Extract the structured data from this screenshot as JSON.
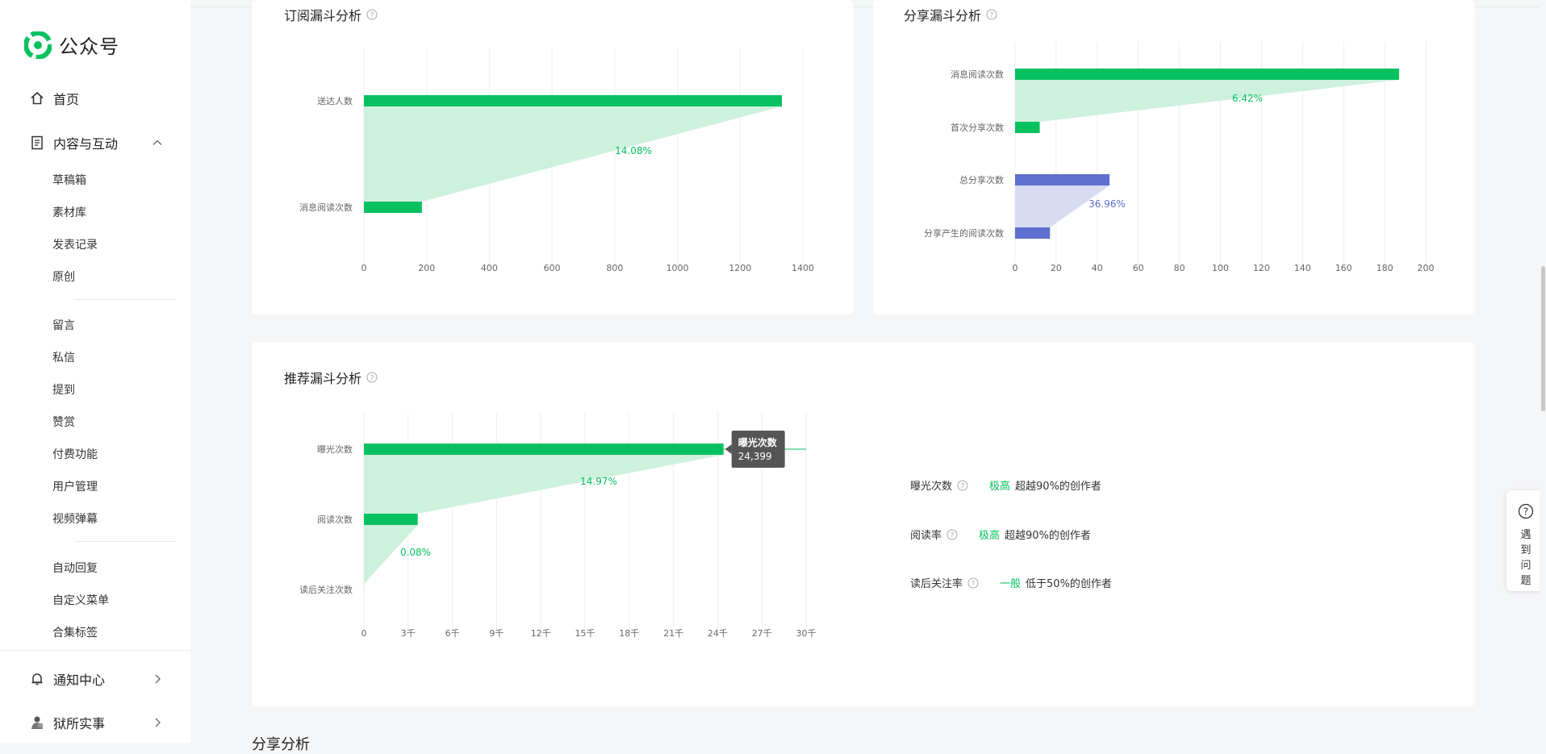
{
  "app": {
    "title": "公众号"
  },
  "sidebar": {
    "home": "首页",
    "content_section": "内容与互动",
    "content_items": [
      "草稿箱",
      "素材库",
      "发表记录",
      "原创"
    ],
    "interaction_items": [
      "留言",
      "私信",
      "提到",
      "赞赏",
      "付费功能",
      "用户管理",
      "视频弹幕"
    ],
    "tool_items": [
      "自动回复",
      "自定义菜单",
      "合集标签"
    ],
    "notifications": "通知中心",
    "account": "狱所实事"
  },
  "cards": {
    "subscribe_title": "订阅漏斗分析",
    "share_title": "分享漏斗分析",
    "recommend_title": "推荐漏斗分析",
    "next_section_title": "分享分析"
  },
  "metrics": [
    {
      "label": "曝光次数",
      "level": "极高",
      "desc": "超越90%的创作者"
    },
    {
      "label": "阅读率",
      "level": "极高",
      "desc": "超越90%的创作者"
    },
    {
      "label": "读后关注率",
      "level": "一般",
      "desc": "低于50%的创作者"
    }
  ],
  "help_float": {
    "text": "遇到问题"
  },
  "colors": {
    "green": "#07c160",
    "green_light": "#cdf1dd",
    "blue": "#5e6fcf",
    "blue_light": "#d8dcf1"
  },
  "chart_data": [
    {
      "type": "bar",
      "title": "订阅漏斗分析",
      "categories": [
        "送达人数",
        "消息阅读次数"
      ],
      "values": [
        1333,
        185
      ],
      "xlim": [
        0,
        1400
      ],
      "xticks": [
        "0",
        "200",
        "400",
        "600",
        "800",
        "1000",
        "1200",
        "1400"
      ],
      "conversion_labels": [
        "14.08%"
      ],
      "grid": true
    },
    {
      "type": "bar",
      "title": "分享漏斗分析",
      "categories": [
        "消息阅读次数",
        "首次分享次数",
        "总分享次数",
        "分享产生的阅读次数"
      ],
      "values": [
        187,
        12,
        46,
        17
      ],
      "xlim": [
        0,
        200
      ],
      "xticks": [
        "0",
        "20",
        "40",
        "60",
        "80",
        "100",
        "120",
        "140",
        "160",
        "180",
        "200"
      ],
      "conversion_labels": [
        "6.42%",
        "36.96%"
      ],
      "grid": true
    },
    {
      "type": "bar",
      "title": "推荐漏斗分析",
      "categories": [
        "曝光次数",
        "阅读次数",
        "读后关注次数"
      ],
      "values": [
        24399,
        3653,
        3
      ],
      "xlim": [
        0,
        30000
      ],
      "xticks": [
        "0",
        "3千",
        "6千",
        "9千",
        "12千",
        "15千",
        "18千",
        "21千",
        "24千",
        "27千",
        "30千"
      ],
      "conversion_labels": [
        "14.97%",
        "0.08%"
      ],
      "tooltip": {
        "label": "曝光次数",
        "value": "24,399"
      },
      "grid": true
    }
  ]
}
